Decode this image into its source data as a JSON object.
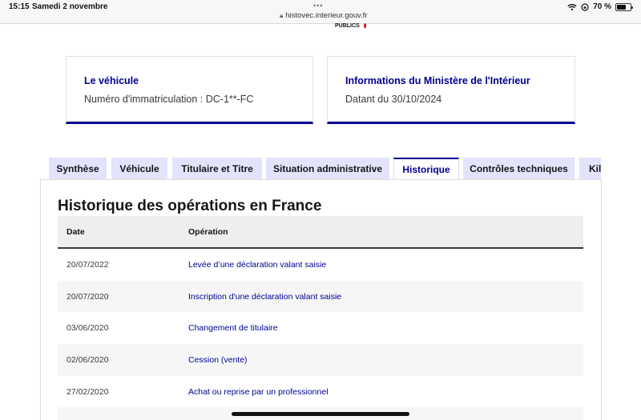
{
  "statusbar": {
    "time": "15:15",
    "date": "Samedi 2 novembre",
    "dots": "•••",
    "url": "histovec.interieur.gouv.fr",
    "battery": "70 %",
    "battery_level": 0.7
  },
  "header_fragment": "PUBLICS",
  "cards": {
    "vehicle": {
      "title": "Le véhicule",
      "text": "Numéro d'immatriculation : DC-1**-FC"
    },
    "ministry": {
      "title": "Informations du Ministère de l'Intérieur",
      "text": "Datant du 30/10/2024"
    }
  },
  "tabs": [
    {
      "label": "Synthèse",
      "active": false
    },
    {
      "label": "Véhicule",
      "active": false
    },
    {
      "label": "Titulaire et Titre",
      "active": false
    },
    {
      "label": "Situation administrative",
      "active": false
    },
    {
      "label": "Historique",
      "active": true
    },
    {
      "label": "Contrôles techniques",
      "active": false
    },
    {
      "label": "Kilo",
      "active": false
    }
  ],
  "section_title": "Historique des opérations en France",
  "table": {
    "headers": {
      "date": "Date",
      "operation": "Opération"
    },
    "rows": [
      {
        "date": "20/07/2022",
        "operation": "Levée d’une déclaration valant saisie"
      },
      {
        "date": "20/07/2020",
        "operation": "Inscription d'une déclaration valant saisie"
      },
      {
        "date": "03/06/2020",
        "operation": "Changement de titulaire"
      },
      {
        "date": "02/06/2020",
        "operation": "Cession (vente)"
      },
      {
        "date": "27/02/2020",
        "operation": "Achat ou reprise par un professionnel"
      },
      {
        "date": "",
        "operation": ""
      }
    ]
  },
  "colors": {
    "accent": "#000091",
    "tab_bg": "#e3e3fd",
    "row_alt": "#f6f6f6",
    "header_bg": "#eeeeee"
  }
}
